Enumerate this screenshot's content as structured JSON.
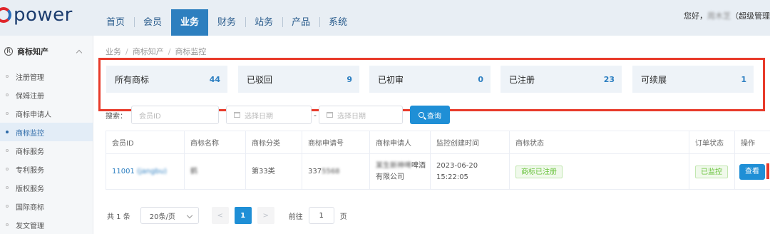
{
  "app": {
    "logo_text": "power",
    "greeting_prefix": "您好，",
    "user_name": "周木芝",
    "greeting_suffix": "（超级管理"
  },
  "nav": [
    {
      "label": "首页"
    },
    {
      "label": "会员"
    },
    {
      "label": "业务"
    },
    {
      "label": "财务"
    },
    {
      "label": "站务"
    },
    {
      "label": "产品"
    },
    {
      "label": "系统"
    }
  ],
  "sidebar": {
    "header_label": "商标知产",
    "items": [
      {
        "label": "注册管理"
      },
      {
        "label": "保姆注册"
      },
      {
        "label": "商标申请人"
      },
      {
        "label": "商标监控"
      },
      {
        "label": "商标服务"
      },
      {
        "label": "专利服务"
      },
      {
        "label": "版权服务"
      },
      {
        "label": "国际商标"
      },
      {
        "label": "发文管理"
      }
    ]
  },
  "breadcrumb": [
    "业务",
    "商标知产",
    "商标监控"
  ],
  "stats": [
    {
      "label": "所有商标",
      "value": "44"
    },
    {
      "label": "已驳回",
      "value": "9"
    },
    {
      "label": "已初审",
      "value": "0"
    },
    {
      "label": "已注册",
      "value": "23"
    },
    {
      "label": "可续展",
      "value": "1"
    }
  ],
  "search": {
    "label": "搜索：",
    "member_placeholder": "会员ID",
    "date_start_placeholder": "选择日期",
    "date_end_placeholder": "选择日期",
    "separator": "-",
    "query_label": "查询"
  },
  "table": {
    "columns": [
      "会员ID",
      "商标名称",
      "商标分类",
      "商标申请号",
      "商标申请人",
      "监控创建时间",
      "商标状态",
      "订单状态",
      "操作"
    ],
    "rows": [
      {
        "member_id": "11001",
        "member_alias": "(jangbu)",
        "tm_name": "鹤",
        "tm_class": "第33类",
        "app_no": "337",
        "app_no_hidden": "5568",
        "applicant_hidden": "某生新神啤",
        "applicant_visible": "啤酒",
        "applicant_line2": "有限公司",
        "created_at": "2023-06-20 15:22:05",
        "tm_status": "商标已注册",
        "order_status": "已监控",
        "action": "查看"
      }
    ]
  },
  "pager": {
    "total": "共 1 条",
    "page_size": "20条/页",
    "prev": "<",
    "current": "1",
    "next": ">",
    "goto_label": "前往",
    "goto_value": "1",
    "page_suffix": "页"
  },
  "colors": {
    "accent": "#2d7fbf",
    "highlight": "#e83a2a",
    "success": "#67c23a"
  }
}
